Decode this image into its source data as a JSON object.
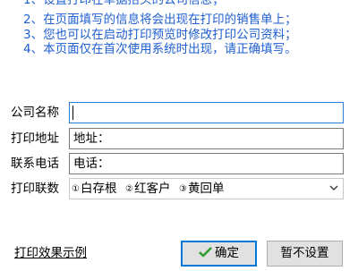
{
  "notes": [
    "1、设置打印在单据抬头的公司信息；",
    "2、在页面填写的信息将会出现在打印的销售单上；",
    "3、您也可以在启动打印预览时修改打印公司资料；",
    "4、本页面仅在首次使用系统时出现，请正确填写。"
  ],
  "form": {
    "company_name": {
      "label": "公司名称",
      "value": ""
    },
    "print_address": {
      "label": "打印地址",
      "value": "地址："
    },
    "phone": {
      "label": "联系电话",
      "value": "电话："
    },
    "copies": {
      "label": "打印联数",
      "options": [
        {
          "mark": "①",
          "text": "白存根"
        },
        {
          "mark": "②",
          "text": "红客户"
        },
        {
          "mark": "③",
          "text": "黄回单"
        }
      ]
    }
  },
  "footer": {
    "example_link": "打印效果示例",
    "ok_label": "确定",
    "skip_label": "暂不设置"
  },
  "colors": {
    "note_text": "#1f5fd1",
    "focus_border": "#2d7fd3",
    "default_button_border": "#0078d7",
    "check_icon": "#2e9e2e"
  }
}
